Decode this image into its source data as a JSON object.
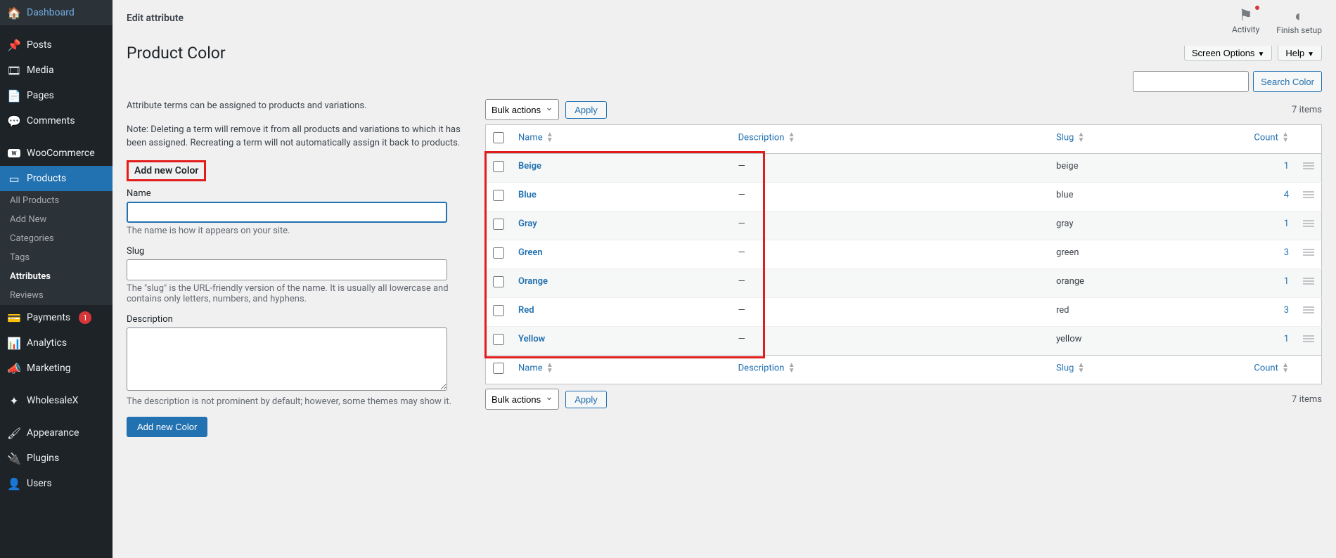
{
  "sidebar": {
    "items": [
      {
        "icon": "dashboard",
        "label": "Dashboard"
      },
      {
        "icon": "pin",
        "label": "Posts"
      },
      {
        "icon": "media",
        "label": "Media"
      },
      {
        "icon": "pages",
        "label": "Pages"
      },
      {
        "icon": "comments",
        "label": "Comments"
      },
      {
        "icon": "woo",
        "label": "WooCommerce"
      },
      {
        "icon": "products",
        "label": "Products",
        "active": true
      },
      {
        "icon": "payments",
        "label": "Payments",
        "badge": "1"
      },
      {
        "icon": "analytics",
        "label": "Analytics"
      },
      {
        "icon": "marketing",
        "label": "Marketing"
      },
      {
        "icon": "wholesale",
        "label": "WholesaleX"
      },
      {
        "icon": "appearance",
        "label": "Appearance"
      },
      {
        "icon": "plugins",
        "label": "Plugins"
      },
      {
        "icon": "users",
        "label": "Users"
      }
    ],
    "submenu": [
      {
        "label": "All Products"
      },
      {
        "label": "Add New"
      },
      {
        "label": "Categories"
      },
      {
        "label": "Tags"
      },
      {
        "label": "Attributes",
        "current": true
      },
      {
        "label": "Reviews"
      }
    ]
  },
  "breadcrumb": "Edit attribute",
  "top_icons": {
    "activity": "Activity",
    "finish": "Finish setup"
  },
  "screen_options": "Screen Options",
  "help": "Help",
  "page_title": "Product Color",
  "search": {
    "button": "Search Color"
  },
  "intro": "Attribute terms can be assigned to products and variations.",
  "note": "Note: Deleting a term will remove it from all products and variations to which it has been assigned. Recreating a term will not automatically assign it back to products.",
  "form": {
    "heading": "Add new Color",
    "name_label": "Name",
    "name_help": "The name is how it appears on your site.",
    "slug_label": "Slug",
    "slug_help": "The \"slug\" is the URL-friendly version of the name. It is usually all lowercase and contains only letters, numbers, and hyphens.",
    "desc_label": "Description",
    "desc_help": "The description is not prominent by default; however, some themes may show it.",
    "submit": "Add new Color"
  },
  "table": {
    "bulk": "Bulk actions",
    "apply": "Apply",
    "items_text": "7 items",
    "headers": {
      "name": "Name",
      "description": "Description",
      "slug": "Slug",
      "count": "Count"
    },
    "rows": [
      {
        "name": "Beige",
        "description": "—",
        "slug": "beige",
        "count": "1"
      },
      {
        "name": "Blue",
        "description": "—",
        "slug": "blue",
        "count": "4"
      },
      {
        "name": "Gray",
        "description": "—",
        "slug": "gray",
        "count": "1"
      },
      {
        "name": "Green",
        "description": "—",
        "slug": "green",
        "count": "3"
      },
      {
        "name": "Orange",
        "description": "—",
        "slug": "orange",
        "count": "1"
      },
      {
        "name": "Red",
        "description": "—",
        "slug": "red",
        "count": "3"
      },
      {
        "name": "Yellow",
        "description": "—",
        "slug": "yellow",
        "count": "1"
      }
    ]
  }
}
